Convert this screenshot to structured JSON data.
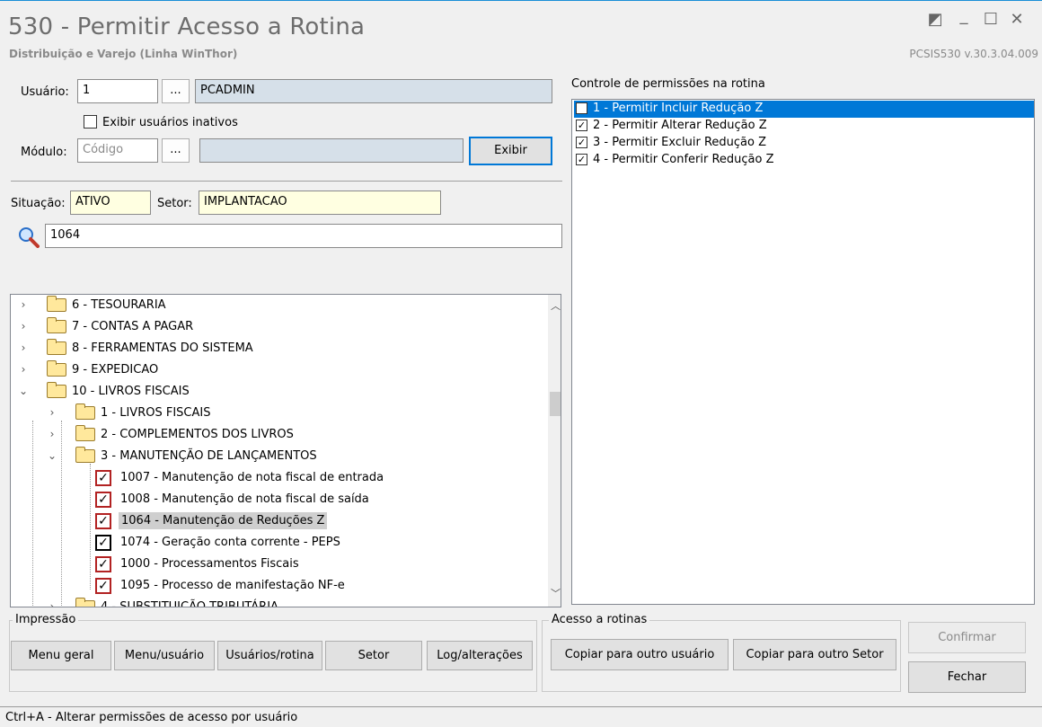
{
  "window": {
    "title": "530 - Permitir Acesso a Rotina",
    "subtitle": "Distribuição e Varejo (Linha WinThor)",
    "version": "PCSIS530  v.30.3.04.009",
    "controls": {
      "restore": "◩",
      "minimize": "_",
      "maximize": "☐",
      "close": "✕"
    }
  },
  "user": {
    "label": "Usuário:",
    "code": "1",
    "lookup": "...",
    "name": "PCADMIN",
    "inactive_label": "Exibir usuários inativos"
  },
  "module": {
    "label": "Módulo:",
    "placeholder": "Código",
    "lookup": "...",
    "show_button": "Exibir"
  },
  "situation": {
    "label": "Situação:",
    "value": "ATIVO"
  },
  "sector": {
    "label": "Setor:",
    "value": "IMPLANTACAO"
  },
  "search": {
    "value": "1064"
  },
  "tree": [
    {
      "text": "6 - TESOURARIA",
      "type": "folder",
      "expanded": false
    },
    {
      "text": "7 - CONTAS A PAGAR",
      "type": "folder",
      "expanded": false
    },
    {
      "text": "8 - FERRAMENTAS DO SISTEMA",
      "type": "folder",
      "expanded": false
    },
    {
      "text": "9 - EXPEDICAO",
      "type": "folder",
      "expanded": false
    },
    {
      "text": "10 - LIVROS FISCAIS",
      "type": "folder",
      "expanded": true
    },
    {
      "text": "1 - LIVROS FISCAIS",
      "type": "folder",
      "expanded": false
    },
    {
      "text": "2 - COMPLEMENTOS DOS LIVROS",
      "type": "folder",
      "expanded": false
    },
    {
      "text": "3 - MANUTENÇÃO DE LANÇAMENTOS",
      "type": "folder",
      "expanded": true
    },
    {
      "text": "1007 - Manutenção de nota fiscal de entrada",
      "type": "check"
    },
    {
      "text": "1008 - Manutenção de nota fiscal de saída",
      "type": "check"
    },
    {
      "text": "1064 - Manutenção de Reduções Z",
      "type": "check",
      "selected": true
    },
    {
      "text": "1074 - Geração conta corrente - PEPS",
      "type": "check",
      "black": true
    },
    {
      "text": "1000 - Processamentos Fiscais",
      "type": "check"
    },
    {
      "text": "1095 - Processo de manifestação NF-e",
      "type": "check"
    },
    {
      "text": "4 - SUBSTITUIÇÃO TRIBUTÁRIA",
      "type": "folder",
      "expanded": false
    }
  ],
  "permissions": {
    "title": "Controle de permissões na rotina",
    "items": [
      {
        "label": "1 - Permitir Incluir Redução Z",
        "checked": false,
        "selected": true
      },
      {
        "label": "2 - Permitir Alterar Redução Z",
        "checked": true
      },
      {
        "label": "3 - Permitir Excluir Redução Z",
        "checked": true
      },
      {
        "label": "4 - Permitir Conferir Redução Z",
        "checked": true
      }
    ]
  },
  "print_group": {
    "title": "Impressão",
    "buttons": [
      "Menu geral",
      "Menu/usuário",
      "Usuários/rotina",
      "Setor",
      "Log/alterações"
    ]
  },
  "access_group": {
    "title": "Acesso a rotinas",
    "buttons": [
      "Copiar para outro usuário",
      "Copiar para outro Setor"
    ]
  },
  "actions": {
    "confirm": "Confirmar",
    "close": "Fechar"
  },
  "status_bar": "Ctrl+A - Alterar permissões de acesso por usuário",
  "colors": {
    "selection": "#0078d7",
    "accent": "#1b8fd6",
    "check_red": "#b22222"
  }
}
